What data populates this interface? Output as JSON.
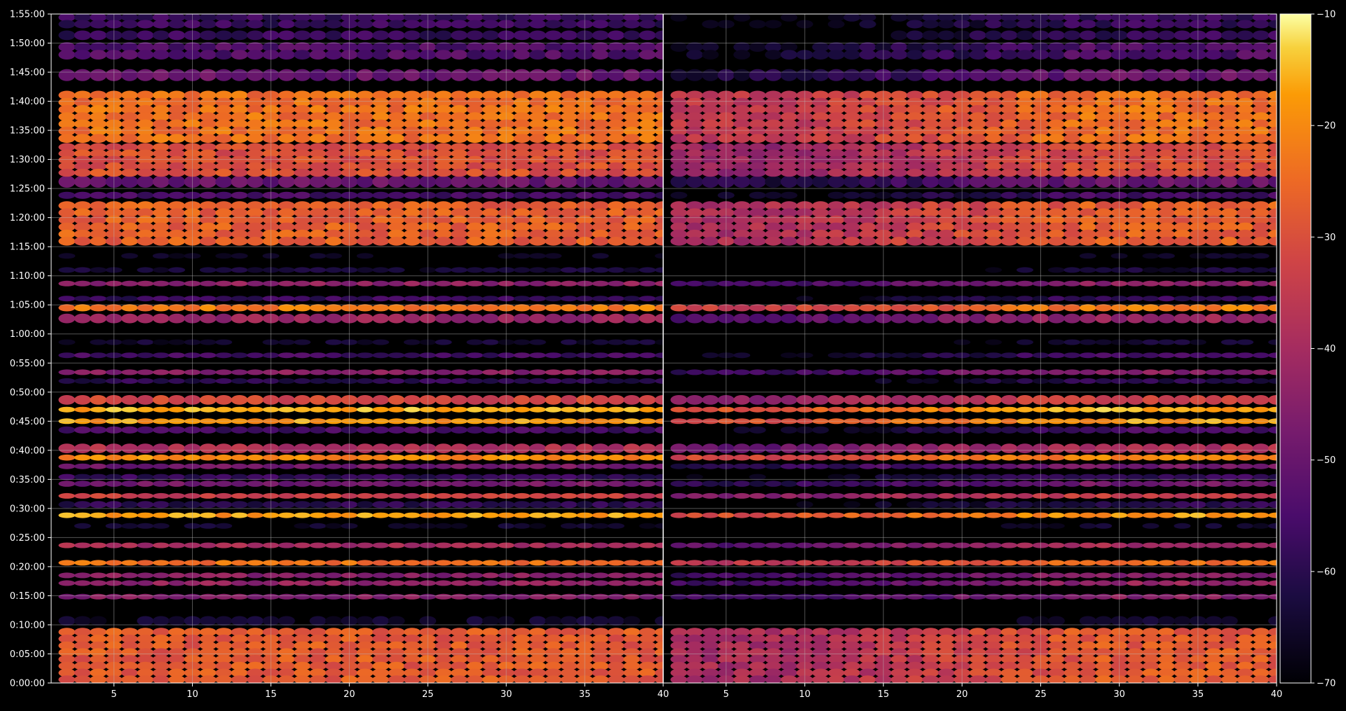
{
  "chart_data": {
    "type": "heatmap",
    "title": "",
    "xlabel": "",
    "ylabel": "",
    "colormap": "inferno",
    "background": "#000000",
    "grid": true,
    "grid_color": "#bbbbbb",
    "panels": [
      {
        "name": "left",
        "xlim": [
          1,
          40
        ],
        "xticks": [
          "5",
          "10",
          "15",
          "20",
          "25",
          "30",
          "35",
          "40"
        ],
        "xtick_values": [
          5,
          10,
          15,
          20,
          25,
          30,
          35,
          40
        ],
        "data_x_range": [
          2,
          40
        ],
        "level_offset_db": 0
      },
      {
        "name": "right",
        "xlim": [
          1,
          40
        ],
        "xticks": [
          "5",
          "10",
          "15",
          "20",
          "25",
          "30",
          "35",
          "40"
        ],
        "xtick_values": [
          5,
          10,
          15,
          20,
          25,
          30,
          35,
          40
        ],
        "data_x_range": [
          2,
          40
        ],
        "level_offset_db": -12,
        "ramp_from_x": 8,
        "ramp_to_x": 28
      }
    ],
    "ylim_seconds": [
      0,
      6900
    ],
    "yticks": [
      "0:00:00",
      "0:05:00",
      "0:10:00",
      "0:15:00",
      "0:20:00",
      "0:25:00",
      "0:30:00",
      "0:35:00",
      "0:40:00",
      "0:45:00",
      "0:50:00",
      "0:55:00",
      "1:00:00",
      "1:05:00",
      "1:10:00",
      "1:15:00",
      "1:20:00",
      "1:25:00",
      "1:30:00",
      "1:35:00",
      "1:40:00",
      "1:45:00",
      "1:50:00",
      "1:55:00"
    ],
    "ytick_values_seconds": [
      0,
      300,
      600,
      900,
      1200,
      1500,
      1800,
      2100,
      2400,
      2700,
      3000,
      3300,
      3600,
      3900,
      4200,
      4500,
      4800,
      5100,
      5400,
      5700,
      6000,
      6300,
      6600,
      6900
    ],
    "colorbar": {
      "range": [
        -70,
        -10
      ],
      "ticks": [
        "-10",
        "-20",
        "-30",
        "-40",
        "-50",
        "-60",
        "-70"
      ],
      "tick_values": [
        -10,
        -20,
        -30,
        -40,
        -50,
        -60,
        -70
      ]
    },
    "bands": [
      {
        "from_s": 0,
        "to_s": 560,
        "level_db": -28
      },
      {
        "from_s": 600,
        "to_s": 680,
        "level_db": -66
      },
      {
        "from_s": 880,
        "to_s": 900,
        "level_db": -45
      },
      {
        "from_s": 1020,
        "to_s": 1040,
        "level_db": -43
      },
      {
        "from_s": 1100,
        "to_s": 1120,
        "level_db": -45
      },
      {
        "from_s": 1230,
        "to_s": 1250,
        "level_db": -24
      },
      {
        "from_s": 1410,
        "to_s": 1430,
        "level_db": -40
      },
      {
        "from_s": 1610,
        "to_s": 1630,
        "level_db": -66
      },
      {
        "from_s": 1720,
        "to_s": 1740,
        "level_db": -18
      },
      {
        "from_s": 1810,
        "to_s": 1870,
        "level_db": -60
      },
      {
        "from_s": 1920,
        "to_s": 1940,
        "level_db": -34
      },
      {
        "from_s": 2030,
        "to_s": 2080,
        "level_db": -48
      },
      {
        "from_s": 2100,
        "to_s": 2150,
        "level_db": -58
      },
      {
        "from_s": 2220,
        "to_s": 2250,
        "level_db": -48
      },
      {
        "from_s": 2300,
        "to_s": 2350,
        "level_db": -20
      },
      {
        "from_s": 2380,
        "to_s": 2460,
        "level_db": -38
      },
      {
        "from_s": 2580,
        "to_s": 2640,
        "level_db": -56
      },
      {
        "from_s": 2680,
        "to_s": 2720,
        "level_db": -18
      },
      {
        "from_s": 2800,
        "to_s": 2840,
        "level_db": -16
      },
      {
        "from_s": 2880,
        "to_s": 2960,
        "level_db": -32
      },
      {
        "from_s": 3100,
        "to_s": 3130,
        "level_db": -60
      },
      {
        "from_s": 3190,
        "to_s": 3220,
        "level_db": -45
      },
      {
        "from_s": 3360,
        "to_s": 3400,
        "level_db": -56
      },
      {
        "from_s": 3500,
        "to_s": 3530,
        "level_db": -65
      },
      {
        "from_s": 3720,
        "to_s": 3800,
        "level_db": -42
      },
      {
        "from_s": 3840,
        "to_s": 3900,
        "level_db": -22
      },
      {
        "from_s": 3950,
        "to_s": 3980,
        "level_db": -58
      },
      {
        "from_s": 4100,
        "to_s": 4140,
        "level_db": -44
      },
      {
        "from_s": 4240,
        "to_s": 4280,
        "level_db": -64
      },
      {
        "from_s": 4390,
        "to_s": 4420,
        "level_db": -68
      },
      {
        "from_s": 4520,
        "to_s": 4960,
        "level_db": -27
      },
      {
        "from_s": 5000,
        "to_s": 5060,
        "level_db": -56
      },
      {
        "from_s": 5120,
        "to_s": 5220,
        "level_db": -50
      },
      {
        "from_s": 5230,
        "to_s": 5560,
        "level_db": -30
      },
      {
        "from_s": 5580,
        "to_s": 6100,
        "level_db": -24
      },
      {
        "from_s": 6220,
        "to_s": 6320,
        "level_db": -50
      },
      {
        "from_s": 6440,
        "to_s": 6600,
        "level_db": -54
      },
      {
        "from_s": 6640,
        "to_s": 6720,
        "level_db": -58
      },
      {
        "from_s": 6760,
        "to_s": 6900,
        "level_db": -58
      }
    ]
  }
}
